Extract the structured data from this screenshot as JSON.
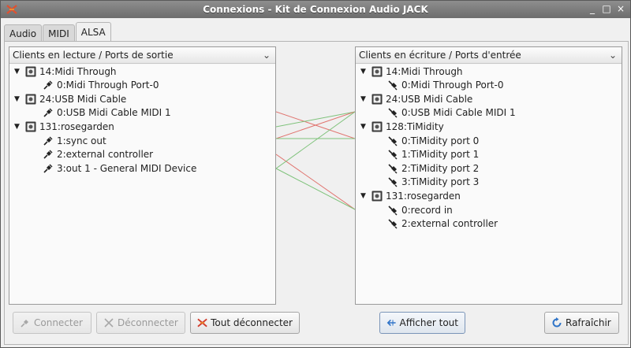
{
  "window": {
    "title": "Connexions - Kit de Connexion Audio JACK",
    "controls": {
      "minimize": "_",
      "maximize": "□",
      "close": "×"
    }
  },
  "tabs": [
    {
      "label": "Audio"
    },
    {
      "label": "MIDI"
    },
    {
      "label": "ALSA"
    }
  ],
  "active_tab": "ALSA",
  "left_panel": {
    "header": "Clients en lecture / Ports de sortie",
    "clients": [
      {
        "name": "14:Midi Through",
        "ports": [
          "0:Midi Through Port-0"
        ]
      },
      {
        "name": "24:USB Midi Cable",
        "ports": [
          "0:USB Midi Cable MIDI 1"
        ]
      },
      {
        "name": "131:rosegarden",
        "ports": [
          "1:sync out",
          "2:external controller",
          "3:out 1 - General MIDI Device"
        ]
      }
    ]
  },
  "right_panel": {
    "header": "Clients en écriture / Ports d'entrée",
    "clients": [
      {
        "name": "14:Midi Through",
        "ports": [
          "0:Midi Through Port-0"
        ]
      },
      {
        "name": "24:USB Midi Cable",
        "ports": [
          "0:USB Midi Cable MIDI 1"
        ]
      },
      {
        "name": "128:TiMidity",
        "ports": [
          "0:TiMidity port 0",
          "1:TiMidity port 1",
          "2:TiMidity port 2",
          "3:TiMidity port 3"
        ]
      },
      {
        "name": "131:rosegarden",
        "ports": [
          "0:record in",
          "2:external controller"
        ]
      }
    ]
  },
  "buttons": {
    "connect": "Connecter",
    "disconnect": "Déconnecter",
    "disconnect_all": "Tout déconnecter",
    "show_all": "Afficher tout",
    "refresh": "Rafraîchir"
  },
  "colors": {
    "connection_red": "#e0736e",
    "connection_green": "#7ec27a",
    "disconnect_all_icon": "#d23a2a",
    "refresh_icon": "#2f74c8",
    "show_all_icon": "#2f74c8"
  }
}
